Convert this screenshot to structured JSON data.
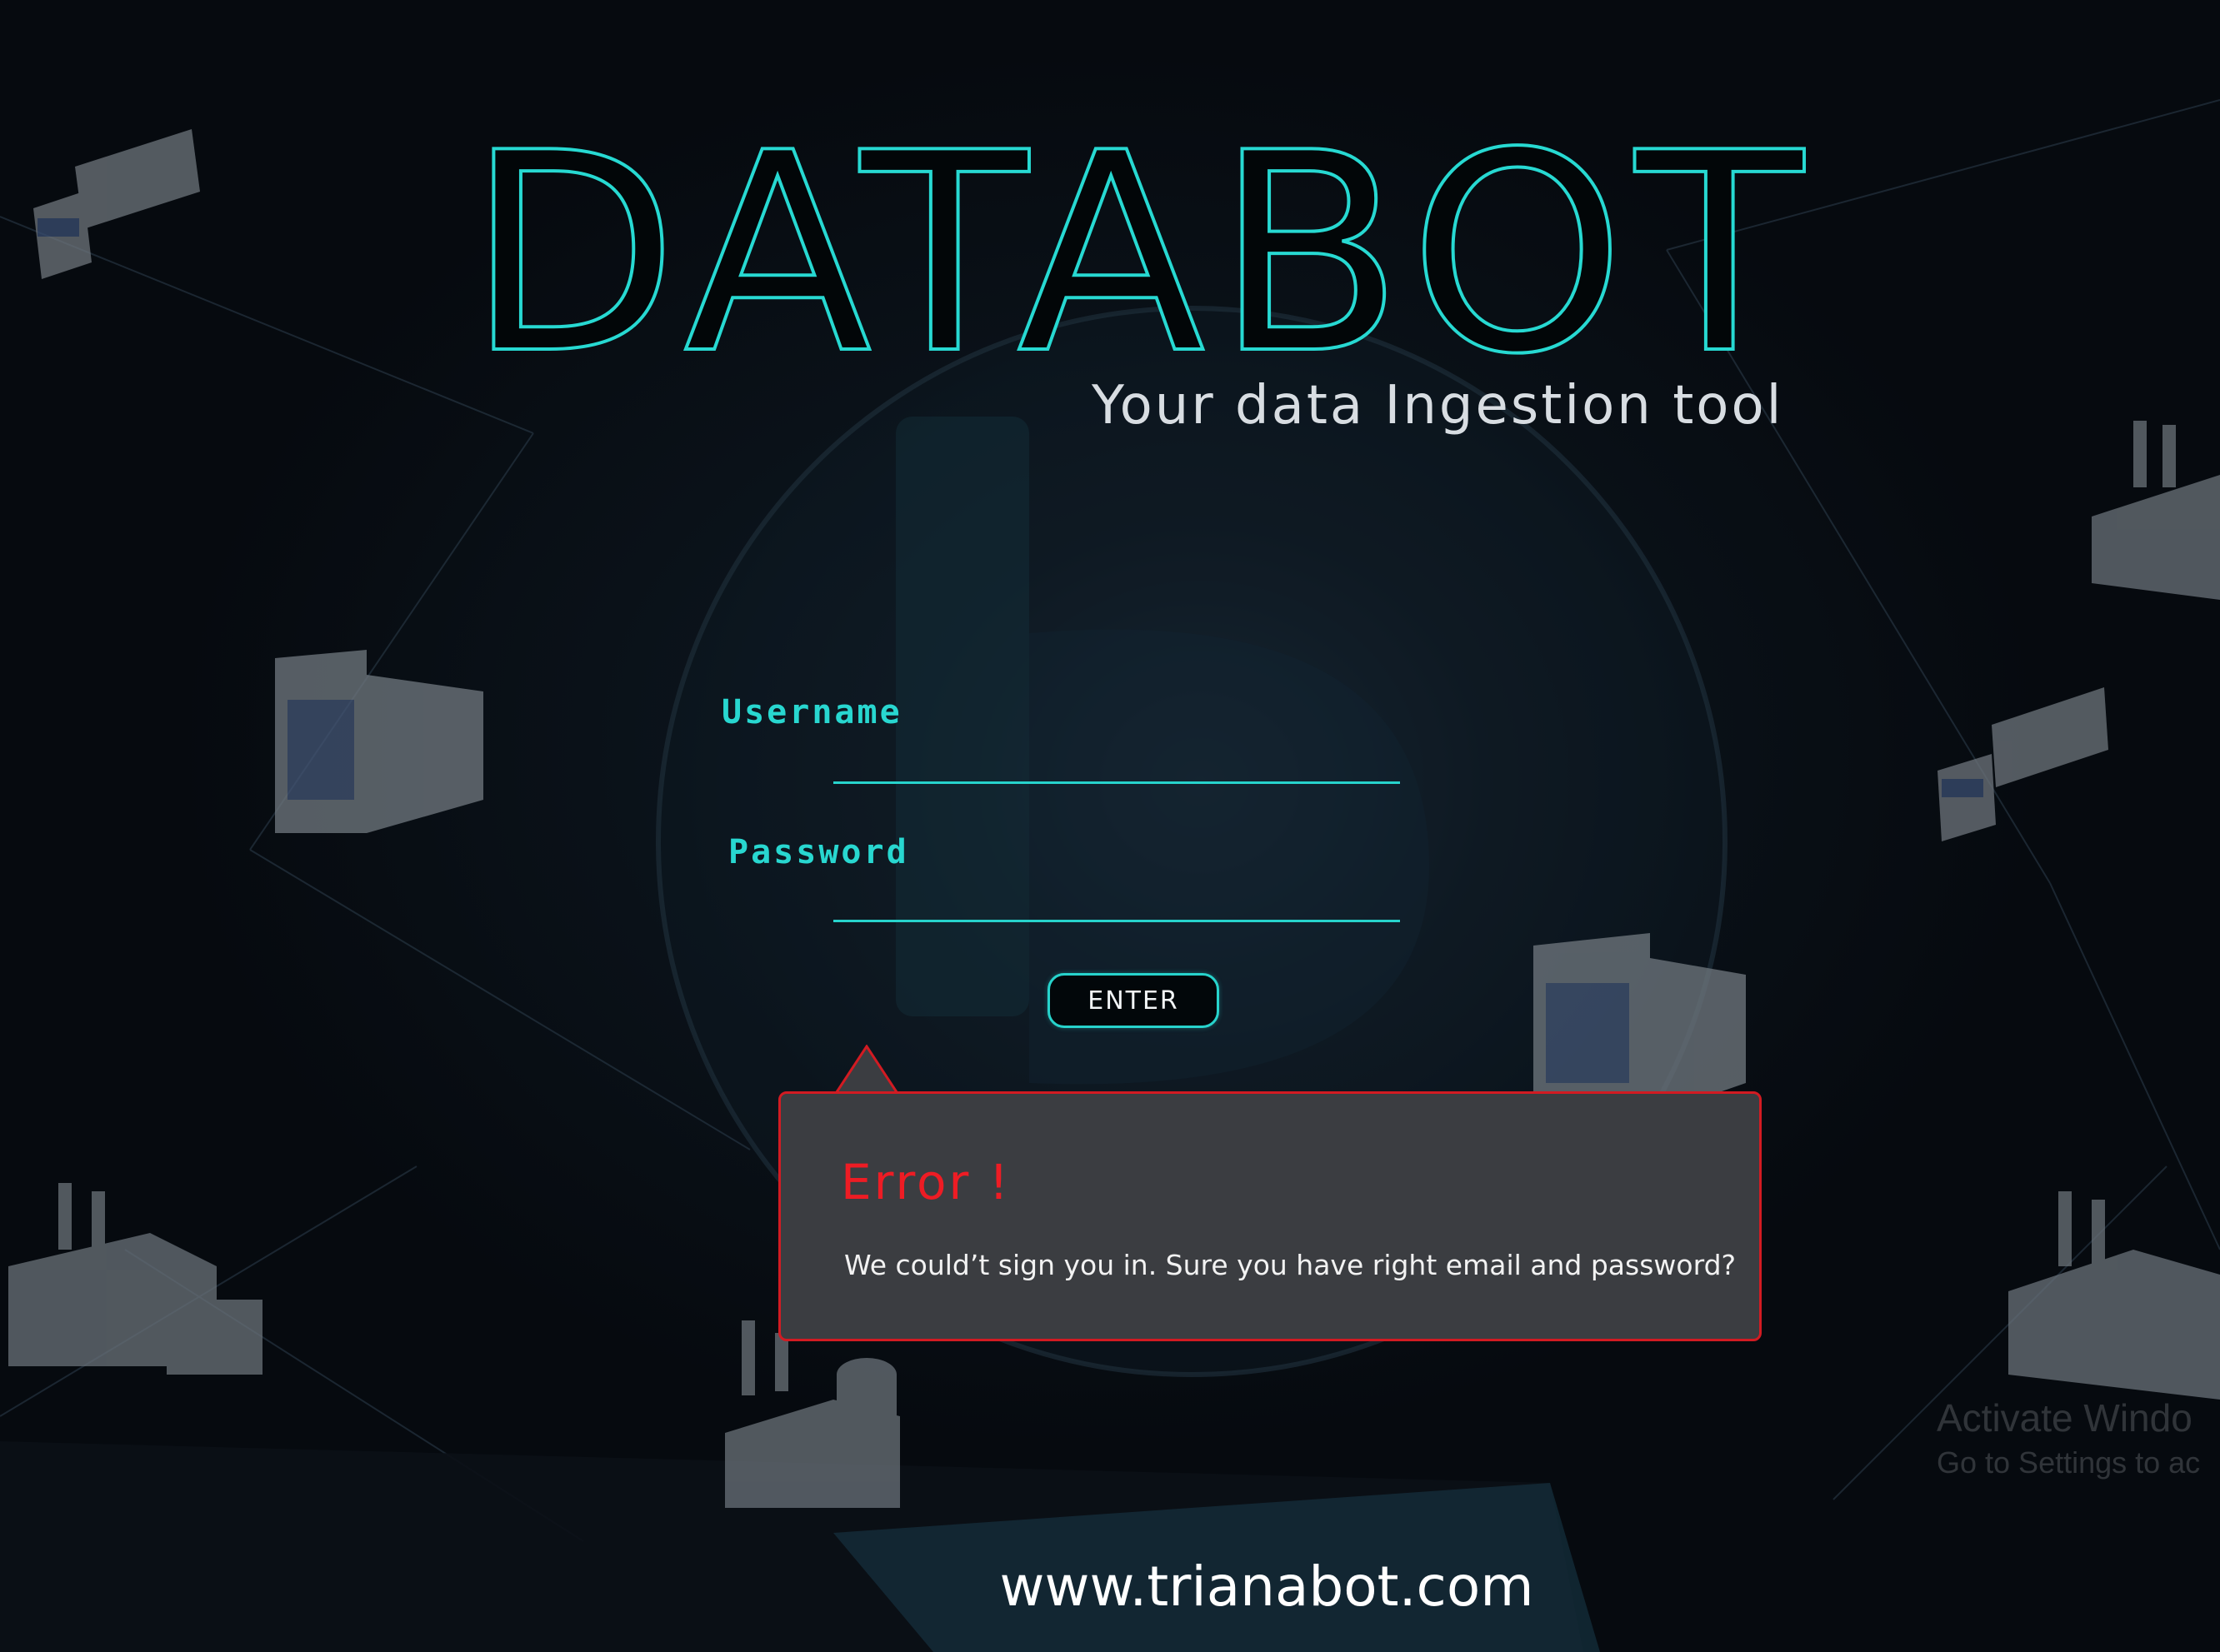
{
  "brand": {
    "title": "DATABOT",
    "subtitle": "Your data Ingestion tool"
  },
  "login": {
    "username_label": "Username",
    "username_value": "",
    "password_label": "Password",
    "password_value": "",
    "enter_label": "ENTER"
  },
  "error": {
    "title": "Error !",
    "message": "We could’t sign you in. Sure you have right email and password?"
  },
  "watermark": {
    "line1": "Activate Windo",
    "line2": "Go to Settings to ac"
  },
  "footer": {
    "url": "www.trianabot.com"
  },
  "icons": [
    "truck-icon",
    "factory-icon",
    "hospital-icon",
    "globe-icon"
  ],
  "colors": {
    "accent": "#27d9d2",
    "error": "#ee1c24",
    "error_box": "#3b3d41",
    "background": "#05080c"
  }
}
